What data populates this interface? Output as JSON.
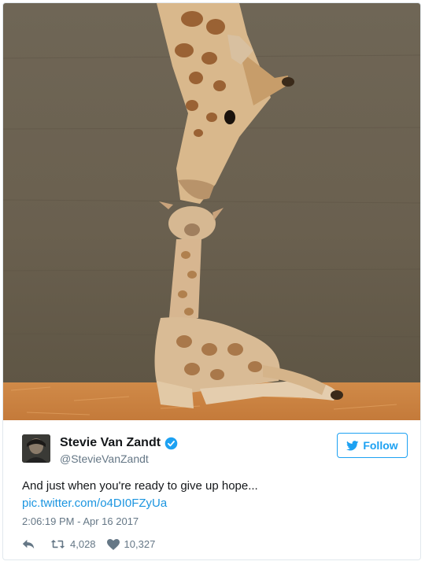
{
  "tweet": {
    "author": {
      "name": "Stevie Van Zandt",
      "handle": "@StevieVanZandt",
      "verified": true
    },
    "follow_label": "Follow",
    "text": "And just when you're ready to give up hope...",
    "link": "pic.twitter.com/o4DI0FZyUa",
    "timestamp": "2:06:19 PM - Apr 16 2017",
    "retweets": "4,028",
    "likes": "10,327"
  },
  "colors": {
    "accent": "#1da1f2",
    "link": "#1b95e0",
    "muted": "#657786",
    "text": "#14171a"
  },
  "icons": [
    "verified-badge-icon",
    "twitter-bird-icon",
    "reply-icon",
    "retweet-icon",
    "heart-icon"
  ]
}
